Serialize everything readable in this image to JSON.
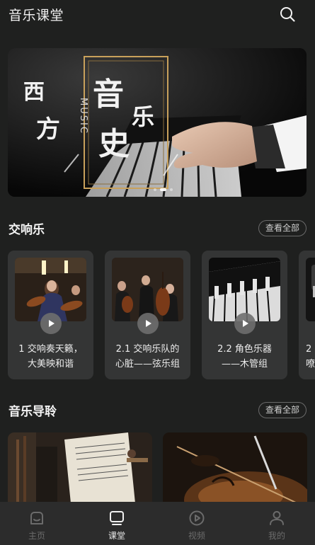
{
  "header": {
    "title": "音乐课堂",
    "search_icon": "search-icon"
  },
  "banner": {
    "title_chars": [
      "西",
      "方",
      "音",
      "乐",
      "史"
    ],
    "vertical_text": "MUSIC",
    "slide_count": 3,
    "active_slide": 1
  },
  "sections": {
    "symphony": {
      "title": "交响乐",
      "view_all": "查看全部"
    },
    "guide": {
      "title": "音乐导聆",
      "view_all": "查看全部"
    }
  },
  "symphony_cards": [
    {
      "line1": "1 交响奏天籁，",
      "line2": "大美映和谐"
    },
    {
      "line1": "2.1 交响乐队的",
      "line2": "心脏——弦乐组"
    },
    {
      "line1": "2.2 角色乐器",
      "line2": "——木管组"
    },
    {
      "line1": "2",
      "line2": "嘹"
    }
  ],
  "tabs": [
    {
      "label": "主页",
      "icon": "home-icon",
      "active": false
    },
    {
      "label": "课堂",
      "icon": "classroom-icon",
      "active": true
    },
    {
      "label": "视频",
      "icon": "video-play-icon",
      "active": false
    },
    {
      "label": "我的",
      "icon": "profile-icon",
      "active": false
    }
  ],
  "colors": {
    "background": "#1f201f",
    "card": "#343535",
    "tabbar": "#2c2c2c",
    "accent_gold": "#c9a15b"
  }
}
